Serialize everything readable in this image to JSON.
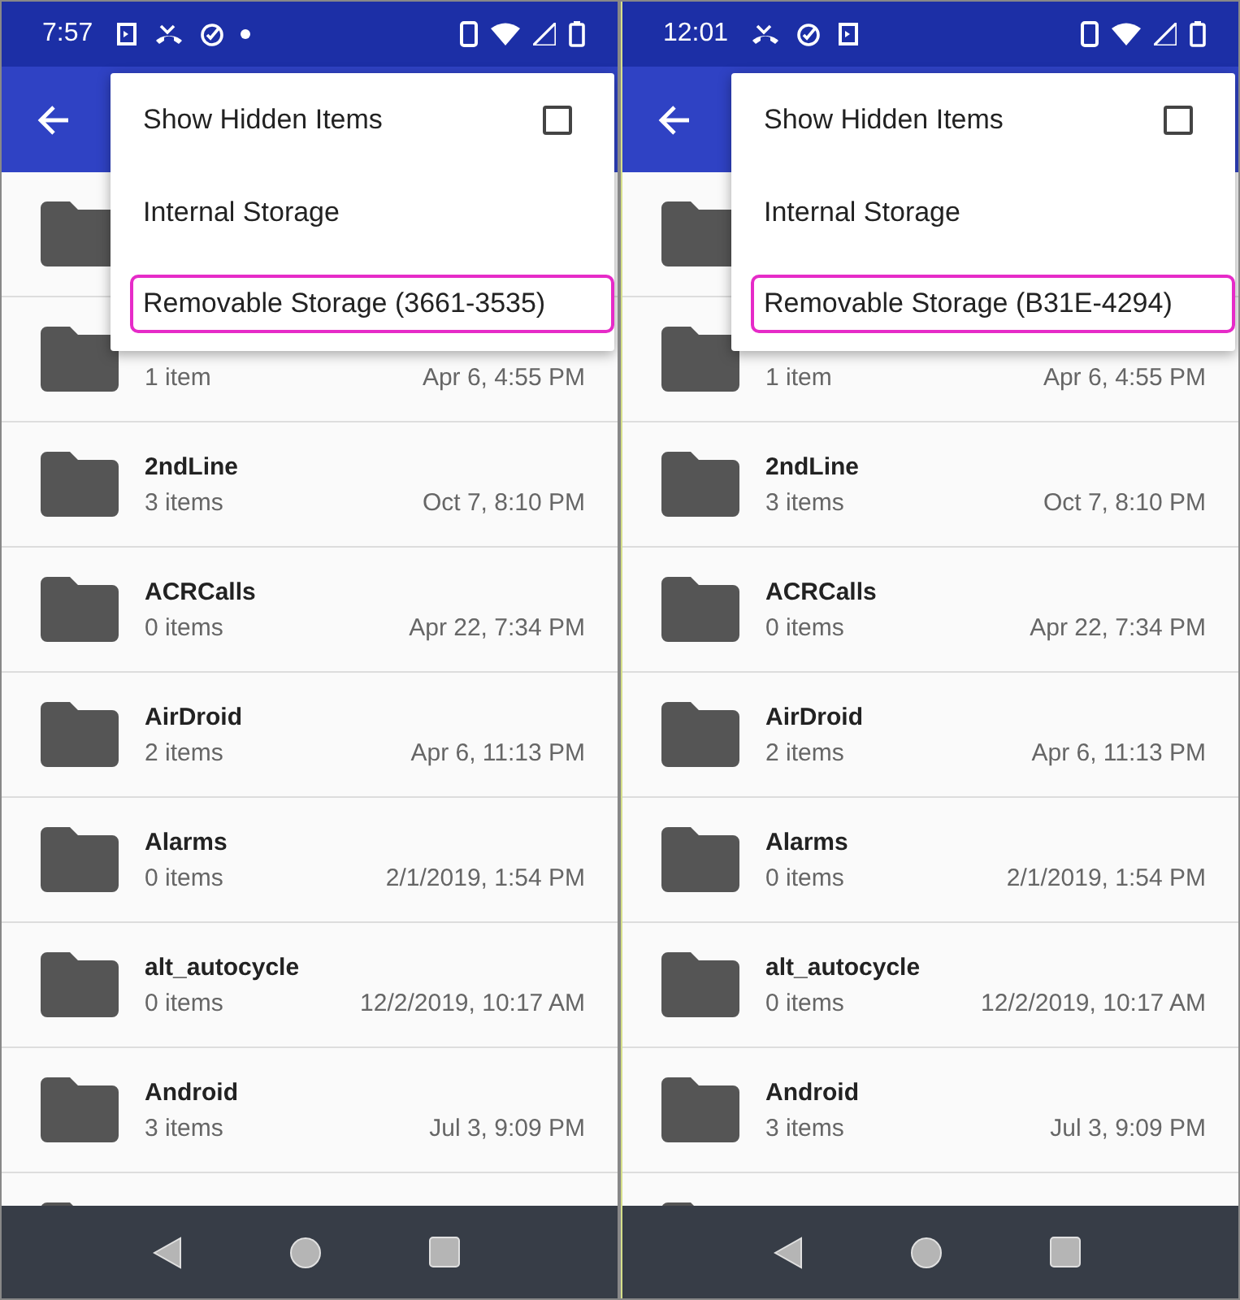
{
  "phones": [
    {
      "status_bar": {
        "time": "7:57"
      },
      "menu": [
        {
          "kind": "checkbox",
          "label": "Show Hidden Items",
          "checked": false,
          "highlighted": false
        },
        {
          "kind": "item",
          "label": "Internal Storage",
          "highlighted": false
        },
        {
          "kind": "item",
          "label": "Removable Storage (3661-3535)",
          "highlighted": true
        }
      ],
      "rows": [
        {},
        {
          "count": "1 item",
          "date": "Apr 6, 4:55 PM"
        },
        {
          "name": "2ndLine",
          "count": "3 items",
          "date": "Oct 7, 8:10 PM"
        },
        {
          "name": "ACRCalls",
          "count": "0 items",
          "date": "Apr 22, 7:34 PM"
        },
        {
          "name": "AirDroid",
          "count": "2 items",
          "date": "Apr 6, 11:13 PM"
        },
        {
          "name": "Alarms",
          "count": "0 items",
          "date": "2/1/2019, 1:54 PM"
        },
        {
          "name": "alt_autocycle",
          "count": "0 items",
          "date": "12/2/2019, 10:17 AM"
        },
        {
          "name": "Android",
          "count": "3 items",
          "date": "Jul 3, 9:09 PM"
        },
        {}
      ]
    },
    {
      "status_bar": {
        "time": "12:01"
      },
      "menu": [
        {
          "kind": "checkbox",
          "label": "Show Hidden Items",
          "checked": false,
          "highlighted": false
        },
        {
          "kind": "item",
          "label": "Internal Storage",
          "highlighted": false
        },
        {
          "kind": "item",
          "label": "Removable Storage (B31E-4294)",
          "highlighted": true
        }
      ],
      "rows": [
        {},
        {
          "count": "1 item",
          "date": "Apr 6, 4:55 PM"
        },
        {
          "name": "2ndLine",
          "count": "3 items",
          "date": "Oct 7, 8:10 PM"
        },
        {
          "name": "ACRCalls",
          "count": "0 items",
          "date": "Apr 22, 7:34 PM"
        },
        {
          "name": "AirDroid",
          "count": "2 items",
          "date": "Apr 6, 11:13 PM"
        },
        {
          "name": "Alarms",
          "count": "0 items",
          "date": "2/1/2019, 1:54 PM"
        },
        {
          "name": "alt_autocycle",
          "count": "0 items",
          "date": "12/2/2019, 10:17 AM"
        },
        {
          "name": "Android",
          "count": "3 items",
          "date": "Jul 3, 9:09 PM"
        },
        {}
      ]
    }
  ]
}
